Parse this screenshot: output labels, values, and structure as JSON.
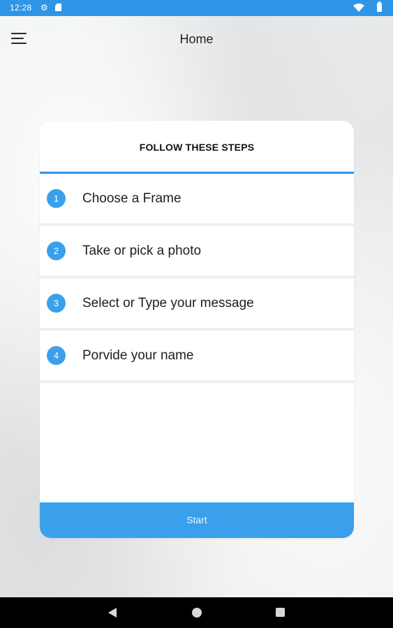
{
  "status_bar": {
    "time": "12:28",
    "icons": [
      "gear-icon",
      "sd-card-icon",
      "wifi-icon",
      "battery-icon"
    ],
    "color": "#2f95e6"
  },
  "header": {
    "title": "Home",
    "menu_icon": "hamburger-menu-icon"
  },
  "card": {
    "title": "FOLLOW THESE STEPS",
    "accent_color": "#3aa0ec",
    "steps": [
      {
        "number": "1",
        "label": "Choose a Frame"
      },
      {
        "number": "2",
        "label": "Take or pick a photo"
      },
      {
        "number": "3",
        "label": "Select or Type your message"
      },
      {
        "number": "4",
        "label": "Porvide your name"
      }
    ],
    "start_label": "Start"
  },
  "nav_bar": {
    "icons": [
      "back-icon",
      "home-icon",
      "recents-icon"
    ]
  }
}
